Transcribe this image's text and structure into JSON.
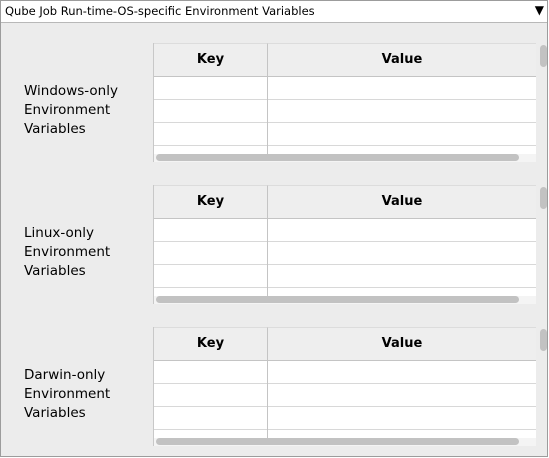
{
  "header": {
    "title": "Qube Job Run-time-OS-specific  Environment Variables",
    "toggle_glyph": "▼"
  },
  "sections": [
    {
      "label": "Windows-only\nEnvironment\nVariables",
      "columns": [
        "Key",
        "Value"
      ]
    },
    {
      "label": "Linux-only\nEnvironment\nVariables",
      "columns": [
        "Key",
        "Value"
      ]
    },
    {
      "label": "Darwin-only\nEnvironment\nVariables",
      "columns": [
        "Key",
        "Value"
      ]
    }
  ],
  "colors": {
    "panel_background": "#ececec",
    "table_background": "#ffffff",
    "header_background": "#eeeeee",
    "scrollbar": "#c2c2c2"
  }
}
